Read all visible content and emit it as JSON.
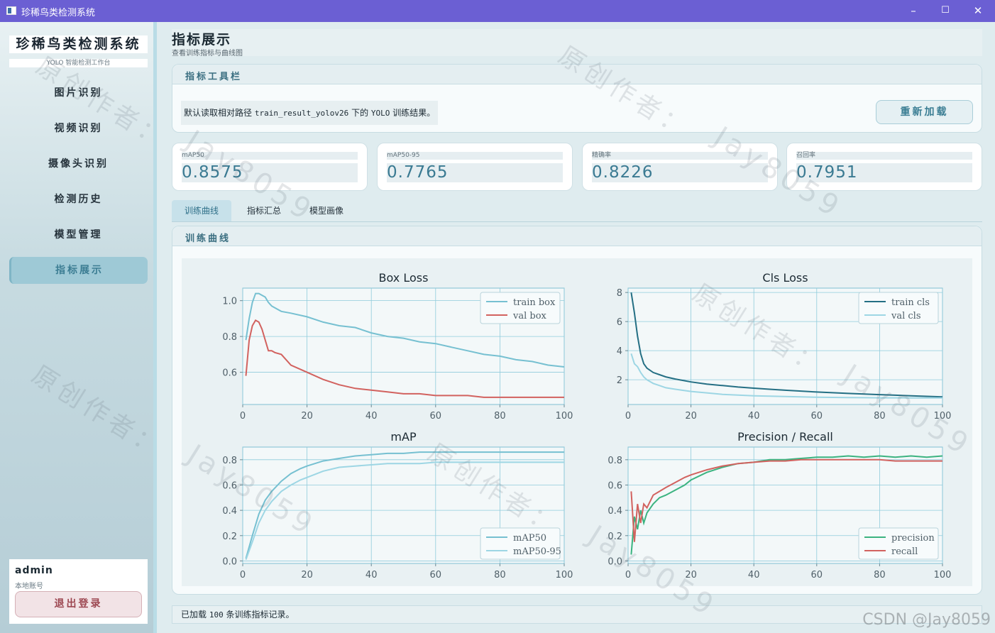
{
  "window": {
    "title": "珍稀鸟类检测系统",
    "minimize_icon": "–",
    "maximize_icon": "☐",
    "close_icon": "✕"
  },
  "sidebar": {
    "brand_title": "珍稀鸟类检测系统",
    "brand_subtitle": "YOLO 智能检测工作台",
    "items": [
      {
        "label": "图片识别"
      },
      {
        "label": "视频识别"
      },
      {
        "label": "摄像头识别"
      },
      {
        "label": "检测历史"
      },
      {
        "label": "模型管理"
      },
      {
        "label": "指标展示",
        "active": true
      }
    ],
    "user": {
      "name": "admin",
      "account_type": "本地账号",
      "logout_label": "退出登录"
    }
  },
  "page": {
    "title": "指标展示",
    "subtitle": "查看训练指标与曲线图"
  },
  "toolbar": {
    "title": "指标工具栏",
    "note_prefix": "默认读取相对路径 ",
    "note_path": "train_result_yolov26",
    "note_mid": " 下的 ",
    "note_yolo": "YOLO",
    "note_suffix": " 训练结果。",
    "reload_label": "重新加载"
  },
  "metrics": [
    {
      "label": "mAP50",
      "value": "0.8575"
    },
    {
      "label": "mAP50-95",
      "value": "0.7765"
    },
    {
      "label": "精确率",
      "value": "0.8226"
    },
    {
      "label": "召回率",
      "value": "0.7951"
    }
  ],
  "tabs": [
    {
      "label": "训练曲线",
      "active": true
    },
    {
      "label": "指标汇总"
    },
    {
      "label": "模型画像"
    }
  ],
  "curves_panel": {
    "title": "训练曲线"
  },
  "status": {
    "prefix": "已加载 ",
    "count": "100",
    "suffix": " 条训练指标记录。"
  },
  "watermarks": {
    "cn": "原创作者：",
    "en": "Jay8059",
    "csdn": "CSDN @Jay8059"
  },
  "colors": {
    "accent": "#3a7a92",
    "titlebar": "#6b5fd3",
    "train_box": "#76c0d1",
    "val_box": "#d2625f",
    "train_cls": "#246f84",
    "val_cls": "#9dd6e4",
    "map50": "#76c0d1",
    "map50_95": "#9dd6e4",
    "precision": "#3bb380",
    "recall": "#d2625f"
  },
  "chart_data": [
    {
      "type": "line",
      "title": "Box Loss",
      "x": [
        1,
        2,
        3,
        4,
        5,
        6,
        7,
        8,
        9,
        10,
        12,
        15,
        20,
        25,
        30,
        35,
        40,
        45,
        50,
        55,
        60,
        65,
        70,
        75,
        80,
        85,
        90,
        95,
        100
      ],
      "series": [
        {
          "name": "train box",
          "values": [
            0.78,
            0.9,
            0.99,
            1.04,
            1.04,
            1.03,
            1.02,
            0.99,
            0.97,
            0.96,
            0.94,
            0.93,
            0.91,
            0.88,
            0.86,
            0.85,
            0.82,
            0.8,
            0.79,
            0.77,
            0.76,
            0.74,
            0.72,
            0.7,
            0.69,
            0.67,
            0.66,
            0.64,
            0.63
          ]
        },
        {
          "name": "val box",
          "values": [
            0.58,
            0.78,
            0.86,
            0.89,
            0.88,
            0.84,
            0.78,
            0.72,
            0.72,
            0.71,
            0.7,
            0.64,
            0.6,
            0.56,
            0.53,
            0.51,
            0.5,
            0.49,
            0.48,
            0.48,
            0.47,
            0.47,
            0.47,
            0.46,
            0.46,
            0.46,
            0.46,
            0.46,
            0.46
          ]
        }
      ],
      "xlim": [
        0,
        100
      ],
      "ylim": [
        0.42,
        1.07
      ],
      "xticks": [
        "0",
        "20",
        "40",
        "60",
        "80",
        "100"
      ],
      "yticks": [
        "0.6",
        "0.8",
        "1.0"
      ],
      "legend": "top-right",
      "grid": true
    },
    {
      "type": "line",
      "title": "Cls Loss",
      "x": [
        1,
        2,
        3,
        4,
        5,
        6,
        8,
        10,
        12,
        15,
        20,
        25,
        30,
        35,
        40,
        45,
        50,
        55,
        60,
        65,
        70,
        75,
        80,
        85,
        90,
        95,
        100
      ],
      "series": [
        {
          "name": "train cls",
          "values": [
            8.0,
            6.6,
            5.0,
            3.8,
            3.1,
            2.8,
            2.5,
            2.35,
            2.2,
            2.05,
            1.85,
            1.7,
            1.6,
            1.5,
            1.42,
            1.35,
            1.28,
            1.22,
            1.16,
            1.11,
            1.06,
            1.02,
            0.98,
            0.94,
            0.9,
            0.86,
            0.82
          ]
        },
        {
          "name": "val cls",
          "values": [
            3.8,
            3.1,
            2.9,
            2.5,
            2.2,
            2.0,
            1.75,
            1.6,
            1.45,
            1.35,
            1.2,
            1.1,
            1.0,
            0.95,
            0.9,
            0.87,
            0.85,
            0.82,
            0.8,
            0.79,
            0.78,
            0.77,
            0.76,
            0.76,
            0.75,
            0.75,
            0.75
          ]
        }
      ],
      "xlim": [
        0,
        100
      ],
      "ylim": [
        0.3,
        8.3
      ],
      "xticks": [
        "0",
        "20",
        "40",
        "60",
        "80",
        "100"
      ],
      "yticks": [
        "2",
        "4",
        "6",
        "8"
      ],
      "legend": "top-right",
      "grid": true
    },
    {
      "type": "line",
      "title": "mAP",
      "x": [
        1,
        3,
        5,
        7,
        9,
        12,
        15,
        18,
        20,
        25,
        30,
        35,
        40,
        45,
        50,
        55,
        60,
        65,
        70,
        75,
        80,
        85,
        90,
        95,
        100
      ],
      "series": [
        {
          "name": "mAP50",
          "values": [
            0.02,
            0.2,
            0.37,
            0.48,
            0.55,
            0.63,
            0.69,
            0.73,
            0.75,
            0.79,
            0.81,
            0.83,
            0.84,
            0.85,
            0.85,
            0.86,
            0.86,
            0.86,
            0.86,
            0.86,
            0.86,
            0.86,
            0.86,
            0.86,
            0.86
          ]
        },
        {
          "name": "mAP50-95",
          "values": [
            0.01,
            0.15,
            0.3,
            0.4,
            0.47,
            0.55,
            0.6,
            0.64,
            0.66,
            0.71,
            0.74,
            0.75,
            0.76,
            0.77,
            0.77,
            0.77,
            0.78,
            0.78,
            0.78,
            0.78,
            0.78,
            0.78,
            0.78,
            0.78,
            0.78
          ]
        }
      ],
      "xlim": [
        0,
        100
      ],
      "ylim": [
        -0.02,
        0.9
      ],
      "xticks": [
        "0",
        "20",
        "40",
        "60",
        "80",
        "100"
      ],
      "yticks": [
        "0.0",
        "0.2",
        "0.4",
        "0.6",
        "0.8"
      ],
      "legend": "bottom-right",
      "grid": true
    },
    {
      "type": "line",
      "title": "Precision / Recall",
      "x": [
        1,
        2,
        3,
        4,
        5,
        6,
        8,
        10,
        12,
        15,
        18,
        20,
        25,
        30,
        35,
        40,
        45,
        50,
        55,
        60,
        65,
        70,
        75,
        80,
        85,
        90,
        95,
        100
      ],
      "series": [
        {
          "name": "precision",
          "values": [
            0.05,
            0.35,
            0.25,
            0.4,
            0.3,
            0.38,
            0.45,
            0.5,
            0.52,
            0.56,
            0.6,
            0.64,
            0.7,
            0.74,
            0.77,
            0.78,
            0.8,
            0.8,
            0.81,
            0.82,
            0.82,
            0.83,
            0.82,
            0.83,
            0.82,
            0.83,
            0.82,
            0.83
          ]
        },
        {
          "name": "recall",
          "values": [
            0.55,
            0.15,
            0.45,
            0.3,
            0.45,
            0.42,
            0.52,
            0.55,
            0.58,
            0.62,
            0.66,
            0.68,
            0.72,
            0.75,
            0.77,
            0.78,
            0.79,
            0.79,
            0.8,
            0.8,
            0.8,
            0.8,
            0.8,
            0.8,
            0.79,
            0.79,
            0.79,
            0.79
          ]
        }
      ],
      "xlim": [
        0,
        100
      ],
      "ylim": [
        -0.02,
        0.9
      ],
      "xticks": [
        "0",
        "20",
        "40",
        "60",
        "80",
        "100"
      ],
      "yticks": [
        "0.0",
        "0.2",
        "0.4",
        "0.6",
        "0.8"
      ],
      "legend": "bottom-right",
      "grid": true
    }
  ]
}
